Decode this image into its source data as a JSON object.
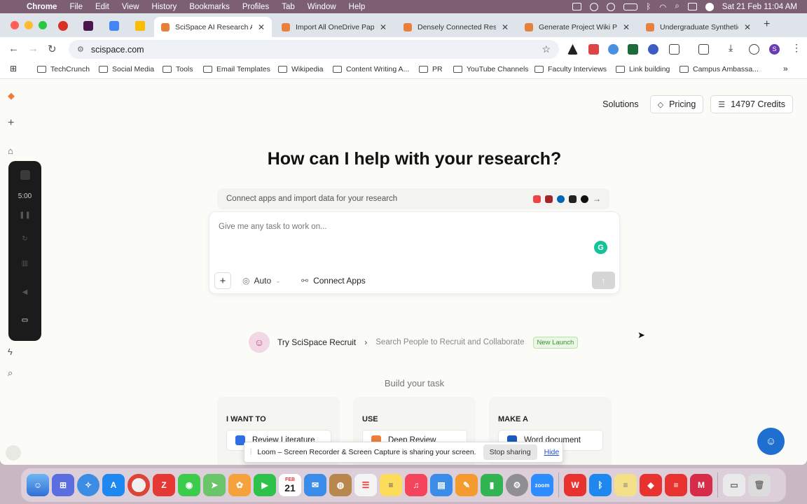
{
  "menubar": {
    "app": "Chrome",
    "items": [
      "File",
      "Edit",
      "View",
      "History",
      "Bookmarks",
      "Profiles",
      "Tab",
      "Window",
      "Help"
    ],
    "datetime": "Sat 21 Feb  11:04 AM"
  },
  "tabs": [
    {
      "label": "SciSpace AI Research Ag",
      "active": true
    },
    {
      "label": "Import All OneDrive Pape",
      "active": false
    },
    {
      "label": "Densely Connected Rese",
      "active": false
    },
    {
      "label": "Generate Project Wiki Pa",
      "active": false
    },
    {
      "label": "Undergraduate Synthetic",
      "active": false
    }
  ],
  "toolbar": {
    "url": "scispace.com",
    "profile_initial": "S"
  },
  "bookmarks": [
    "TechCrunch",
    "Social Media",
    "Tools",
    "Email Templates",
    "Wikipedia",
    "Content Writing A...",
    "PR",
    "YouTube Channels",
    "Faculty Interviews",
    "Link building",
    "Campus Ambassa..."
  ],
  "loom_widget": {
    "timer": "5:00"
  },
  "header": {
    "solutions": "Solutions",
    "pricing": "Pricing",
    "credits": "14797 Credits"
  },
  "main": {
    "heading": "How can I help with your research?",
    "connect_bar": "Connect apps and import data for your research",
    "task_placeholder": "Give me any task to work on...",
    "mode": "Auto",
    "connect_apps": "Connect Apps",
    "recruit_title": "Try SciSpace Recruit",
    "recruit_desc": "Search People to Recruit and Collaborate",
    "recruit_badge": "New Launch",
    "build_label": "Build your task",
    "columns": [
      {
        "header": "I WANT TO",
        "option": "Review Literature"
      },
      {
        "header": "USE",
        "option": "Deep Review"
      },
      {
        "header": "MAKE A",
        "option": "Word document"
      }
    ]
  },
  "loom_banner": {
    "message": "Loom – Screen Recorder & Screen Capture is sharing your screen.",
    "stop": "Stop sharing",
    "hide": "Hide"
  },
  "dock": {
    "calendar_month": "FEB",
    "calendar_day": "21"
  }
}
